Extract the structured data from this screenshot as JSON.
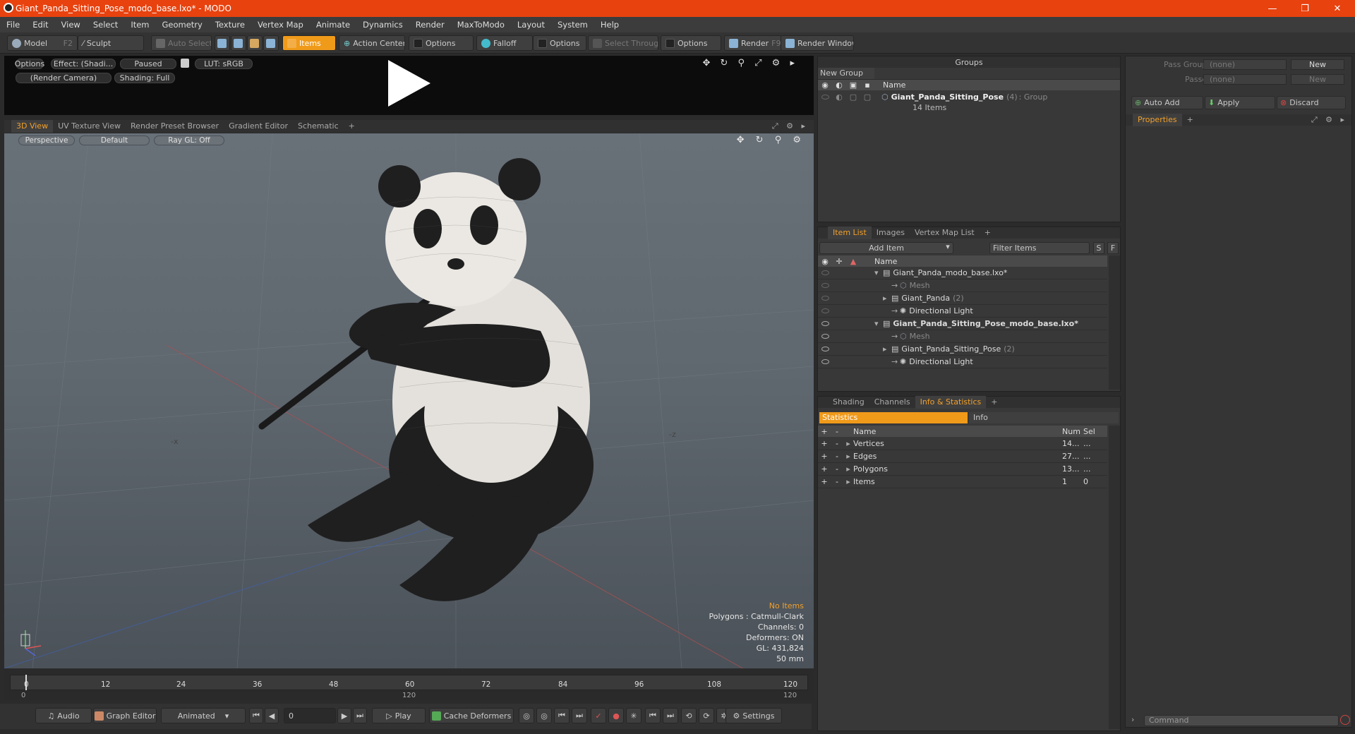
{
  "window": {
    "title": "Giant_Panda_Sitting_Pose_modo_base.lxo* - MODO",
    "minimize": "—",
    "maximize": "❐",
    "close": "✕"
  },
  "menu": [
    "File",
    "Edit",
    "View",
    "Select",
    "Item",
    "Geometry",
    "Texture",
    "Vertex Map",
    "Animate",
    "Dynamics",
    "Render",
    "MaxToModo",
    "Layout",
    "System",
    "Help"
  ],
  "toolbar": {
    "model": "Model",
    "model_key": "F2",
    "sculpt": "Sculpt",
    "auto_select": "Auto Select",
    "items": "Items",
    "action_center": "Action Center",
    "options1": "Options",
    "falloff": "Falloff",
    "options2": "Options",
    "select_through": "Select Through",
    "options3": "Options",
    "render": "Render",
    "render_key": "F9",
    "render_window": "Render Window"
  },
  "preview": {
    "options": "Options",
    "effect": "Effect: (Shadi...",
    "paused": "Paused",
    "lut": "LUT: sRGB",
    "camera": "(Render Camera)",
    "shading": "Shading: Full"
  },
  "viewport_tabs": [
    "3D View",
    "UV Texture View",
    "Render Preset Browser",
    "Gradient Editor",
    "Schematic"
  ],
  "viewport": {
    "perspective": "Perspective",
    "default": "Default",
    "raygl": "Ray GL: Off",
    "stats": {
      "no_items": "No Items",
      "polygons": "Polygons : Catmull-Clark",
      "channels": "Channels: 0",
      "deformers": "Deformers: ON",
      "gl": "GL: 431,824",
      "lens": "50 mm"
    },
    "axis_x": "-x",
    "axis_z": "-z"
  },
  "timeline": {
    "ticks": [
      "0",
      "12",
      "24",
      "36",
      "48",
      "60",
      "72",
      "84",
      "96",
      "108",
      "120"
    ],
    "start": "0",
    "mid": "120",
    "end": "120"
  },
  "transport": {
    "audio": "Audio",
    "graph_editor": "Graph Editor",
    "animated": "Animated",
    "frame": "0",
    "play": "Play",
    "cache": "Cache Deformers",
    "settings": "Settings"
  },
  "groups": {
    "title": "Groups",
    "new_group": "New Group",
    "col_name": "Name",
    "group_name": "Giant_Panda_Sitting_Pose",
    "group_count": "(4)",
    "group_type": ": Group",
    "group_items": "14 Items"
  },
  "item_list": {
    "tabs": [
      "Item List",
      "Images",
      "Vertex Map List"
    ],
    "add_item": "Add Item",
    "filter": "Filter Items",
    "s": "S",
    "f": "F",
    "col_name": "Name",
    "rows": [
      {
        "label": "Giant_Panda_modo_base.lxo*",
        "indent": 0,
        "bold": false,
        "suffix": ""
      },
      {
        "label": "Mesh",
        "indent": 2,
        "bold": false,
        "suffix": ""
      },
      {
        "label": "Giant_Panda",
        "indent": 1,
        "bold": false,
        "suffix": "(2)"
      },
      {
        "label": "Directional Light",
        "indent": 2,
        "bold": false,
        "suffix": ""
      },
      {
        "label": "Giant_Panda_Sitting_Pose_modo_base.lxo*",
        "indent": 0,
        "bold": true,
        "suffix": ""
      },
      {
        "label": "Mesh",
        "indent": 2,
        "bold": false,
        "suffix": ""
      },
      {
        "label": "Giant_Panda_Sitting_Pose",
        "indent": 1,
        "bold": false,
        "suffix": "(2)"
      },
      {
        "label": "Directional Light",
        "indent": 2,
        "bold": false,
        "suffix": ""
      }
    ]
  },
  "info": {
    "tabs": [
      "Shading",
      "Channels",
      "Info & Statistics"
    ],
    "sub_tabs": [
      "Statistics",
      "Info"
    ],
    "cols": {
      "name": "Name",
      "num": "Num",
      "sel": "Sel"
    },
    "rows": [
      {
        "name": "Vertices",
        "num": "14...",
        "sel": "..."
      },
      {
        "name": "Edges",
        "num": "27...",
        "sel": "..."
      },
      {
        "name": "Polygons",
        "num": "13...",
        "sel": "..."
      },
      {
        "name": "Items",
        "num": "1",
        "sel": "0"
      }
    ]
  },
  "passes": {
    "pass_groups": "Pass Groups",
    "passes": "Passes",
    "none1": "(none)",
    "none2": "(none)",
    "new1": "New",
    "new2": "New",
    "auto_add": "Auto Add",
    "apply": "Apply",
    "discard": "Discard",
    "properties": "Properties"
  },
  "command": {
    "placeholder": "Command"
  },
  "colors": {
    "accent": "#f09a1a",
    "titlebar": "#e8420f"
  }
}
